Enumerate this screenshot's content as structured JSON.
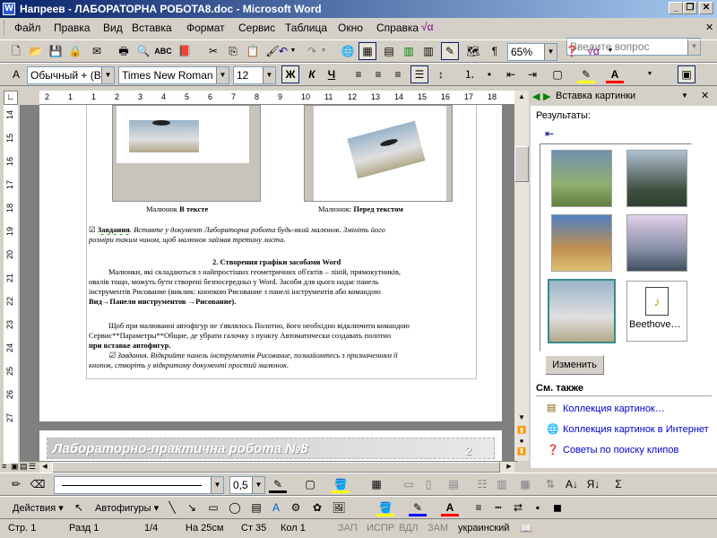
{
  "window": {
    "title": "Напреев - ЛАБОРАТОРНА РОБОТА8.doc - Microsoft Word"
  },
  "menu": {
    "items": [
      "Файл",
      "Правка",
      "Вид",
      "Вставка",
      "Формат",
      "Сервис",
      "Таблица",
      "Окно",
      "Справка"
    ],
    "help_placeholder": "Введите вопрос"
  },
  "standard": {
    "zoom": "65%"
  },
  "formatting": {
    "style": "Обычный + (Вос",
    "font": "Times New Roman",
    "size": "12",
    "bold": "Ж",
    "italic": "К",
    "underline": "Ч"
  },
  "ruler": {
    "marks": [
      "2",
      "1",
      "1",
      "2",
      "3",
      "4",
      "5",
      "6",
      "7",
      "8",
      "9",
      "10",
      "11",
      "12",
      "13",
      "14",
      "15",
      "16",
      "17",
      "18"
    ],
    "vmarks": [
      "14",
      "15",
      "16",
      "17",
      "18",
      "19",
      "20",
      "21",
      "22",
      "23",
      "24",
      "25",
      "26",
      "27"
    ]
  },
  "document": {
    "caption1_a": "Малюнок",
    "caption1_b": "В тексте",
    "caption2_a": "Малюнок:",
    "caption2_b": "Перед текстом",
    "task1_label": "Завдання",
    "task1_text": ". Вставте у документ Лабораторна робота будь-який малюнок. Змініть його",
    "task1_line2": "розміри таким чином, щоб малюнок займав третину листа.",
    "section_heading": "2. Створення графіки засобами Word",
    "para1": [
      "Малюнки, які складаються з найпростіших геометричних об'єктів – ліній, прямокутників,",
      "овалів тощо, можуть бути створені безпосередньо у Word. Засоби для цього надає панель",
      "інструментів Рисование (виклик: кнопкою Рисование з панелі інструментів або командою",
      "Вид→Панели инструментов →Рисование)."
    ],
    "para2": [
      "Щоб при малюванні автофігур не з'являлось Полотно, його необхідно відключити командою",
      "Сервис**Параметры**Общие, де убрати галочку з пункту Автоматически создавать полотно",
      "при вставке автофигур."
    ],
    "task2": [
      "Завдання. Відкрийте панель інструментів Рисование, познайомтесь з призначенням її",
      "кнопок, створіть у відкритому документі простий малюнок."
    ],
    "next_page_header": "Лабораторно-практична робота №8",
    "next_page_number": "2"
  },
  "task_pane": {
    "title": "Вставка картинки",
    "results_label": "Результаты:",
    "thumb_file_label": "Beethove…",
    "change_button": "Изменить",
    "see_also": "См. также",
    "links": [
      "Коллекция картинок…",
      "Коллекция картинок в Интернет",
      "Советы по поиску клипов"
    ]
  },
  "drawing_toolbar": {
    "line_weight": "0,5",
    "actions": "Действия",
    "autoshapes": "Автофигуры"
  },
  "statusbar": {
    "page": "Стр. 1",
    "section": "Разд 1",
    "pages": "1/4",
    "at": "На 25см",
    "line": "Ст 35",
    "col": "Кол 1",
    "rec": "ЗАП",
    "trk": "ИСПР",
    "ext": "ВДЛ",
    "ovr": "ЗАМ",
    "lang": "украинский"
  },
  "colors": {
    "title_start": "#0a246a",
    "title_end": "#a6caf0",
    "link": "#0000cc",
    "font_color": "#ff0000",
    "highlight": "#ffff00"
  }
}
